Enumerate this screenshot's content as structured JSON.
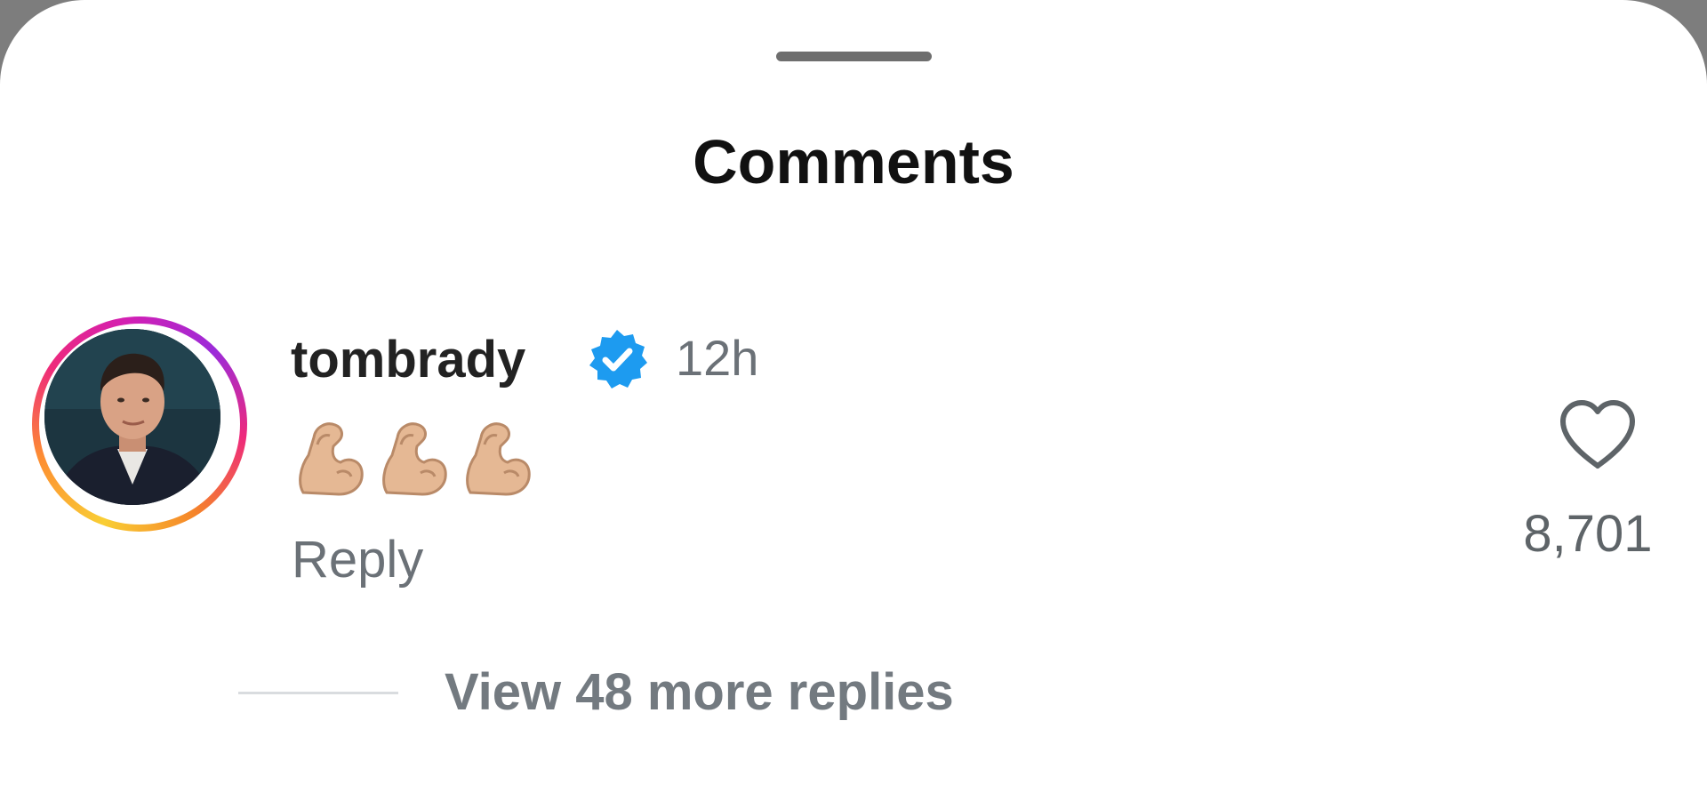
{
  "sheet": {
    "title": "Comments"
  },
  "comment": {
    "username": "tombrady",
    "verified": true,
    "timestamp": "12h",
    "body_emoji": [
      "flexed-biceps",
      "flexed-biceps",
      "flexed-biceps"
    ],
    "reply_label": "Reply",
    "like_count": "8,701",
    "view_replies_label": "View 48 more replies"
  },
  "colors": {
    "verified_badge": "#1d9bf0",
    "secondary_text": "#6b7177",
    "primary_text": "#222222",
    "story_ring": [
      "#f9ce34",
      "#ee2a7b",
      "#d21fb4"
    ]
  },
  "icons": {
    "verified": "verified-badge-icon",
    "like": "heart-outline-icon",
    "emoji": "flexed-biceps-emoji"
  }
}
